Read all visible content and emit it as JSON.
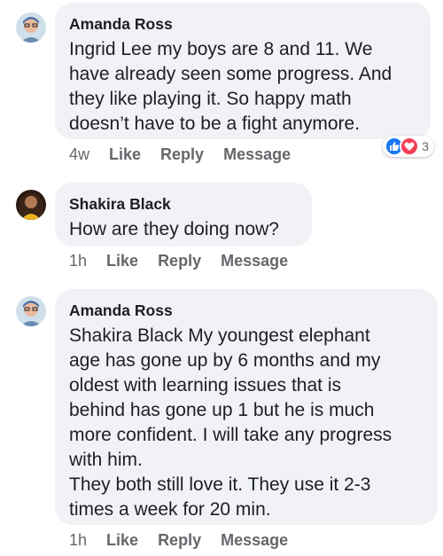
{
  "comments": [
    {
      "author": "Amanda Ross",
      "text": "Ingrid Lee my boys are 8 and 11. We\nhave already seen some progress. And\nthey like playing it. So happy math\ndoesn’t have to be a fight anymore.",
      "time": "4w",
      "like_label": "Like",
      "reply_label": "Reply",
      "message_label": "Message",
      "reactions": {
        "types": [
          "like",
          "love"
        ],
        "count": "3"
      }
    },
    {
      "author": "Shakira Black",
      "text": "How are they doing now?",
      "time": "1h",
      "like_label": "Like",
      "reply_label": "Reply",
      "message_label": "Message"
    },
    {
      "author": "Amanda Ross",
      "text": "Shakira Black My youngest elephant\nage has gone up by 6 months and my\noldest with learning issues that is\nbehind has gone up 1 but he is much\nmore confident. I will take any progress\nwith him.\nThey both still love it. They use it 2-3\ntimes a week for 20 min.",
      "time": "1h",
      "like_label": "Like",
      "reply_label": "Reply",
      "message_label": "Message"
    }
  ],
  "colors": {
    "bubble": "#f0f2f5",
    "meta_text": "#65676b",
    "like_blue": "#1877f2",
    "love_red": "#f33e58"
  }
}
